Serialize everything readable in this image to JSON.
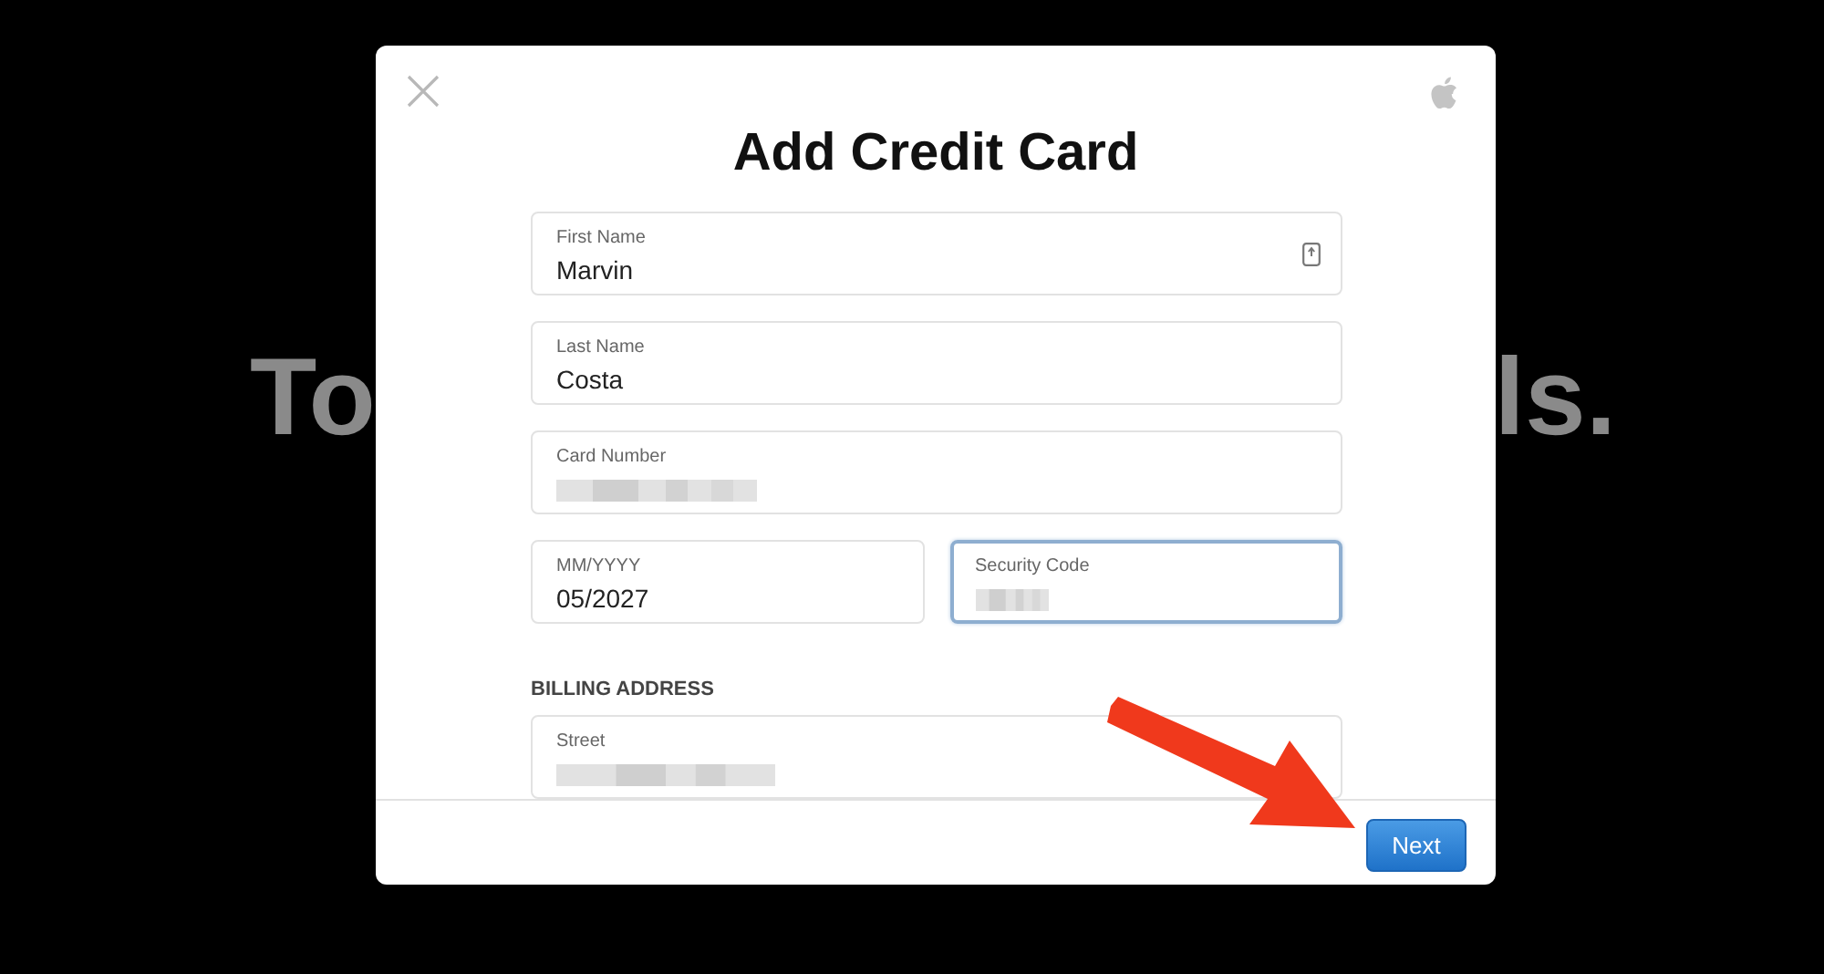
{
  "background_text": [
    {
      "text": "To"
    },
    {
      "text": "ls."
    }
  ],
  "dialog": {
    "title": "Add Credit Card",
    "rows": [
      {
        "fields": [
          {
            "label": "First Name",
            "value": "Marvin",
            "kind": "text",
            "focused": false,
            "contact_icon": true
          }
        ]
      },
      {
        "fields": [
          {
            "label": "Last Name",
            "value": "Costa",
            "kind": "text",
            "focused": false,
            "contact_icon": false
          }
        ]
      },
      {
        "fields": [
          {
            "label": "Card Number",
            "kind": "redacted",
            "focused": false,
            "contact_icon": false
          }
        ]
      },
      {
        "fields": [
          {
            "label": "MM/YYYY",
            "value": "05/2027",
            "kind": "text",
            "focused": false,
            "contact_icon": false
          },
          {
            "label": "Security Code",
            "kind": "redacted",
            "focused": true,
            "contact_icon": false
          }
        ]
      }
    ],
    "section_heading": "BILLING ADDRESS",
    "street": {
      "label": "Street",
      "kind": "redacted",
      "focused": false
    },
    "next_button": "Next"
  }
}
